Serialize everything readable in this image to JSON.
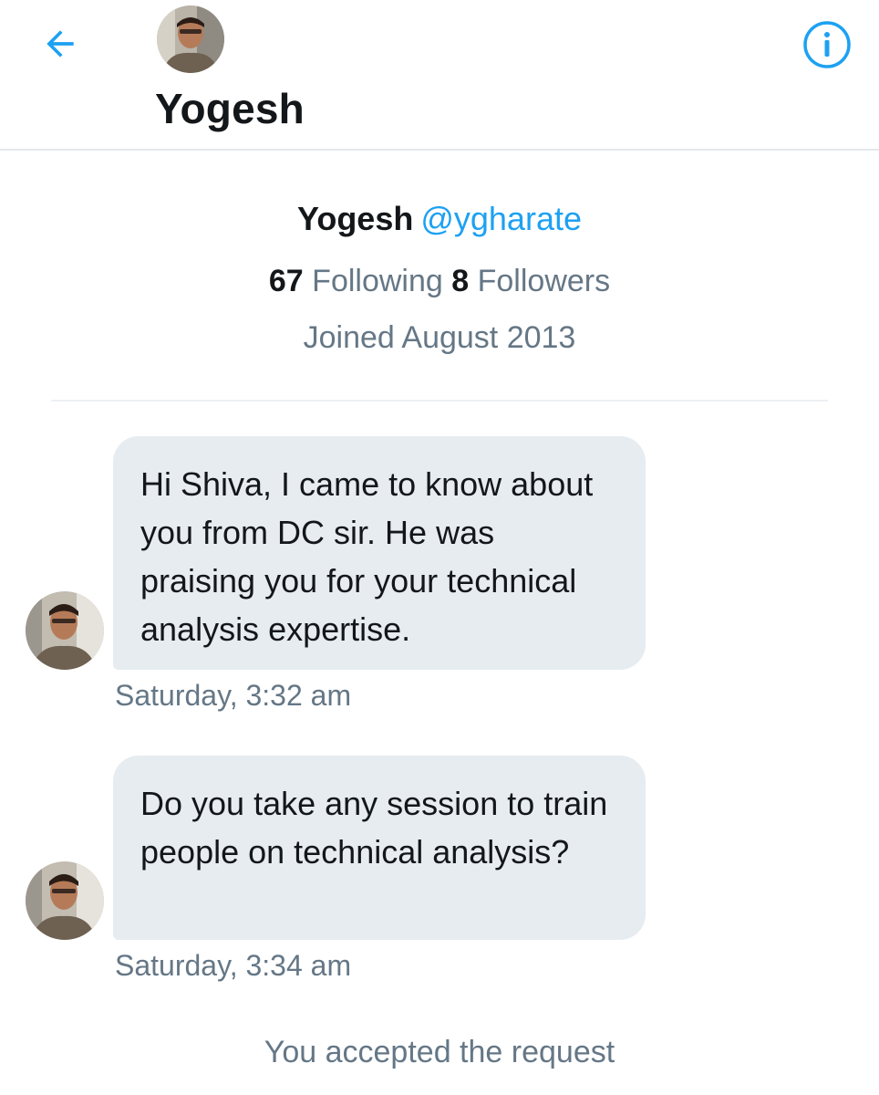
{
  "header": {
    "back_icon": "arrow-left-icon",
    "title": "Yogesh",
    "info_icon": "info-icon",
    "accent_color": "#1da1f2"
  },
  "profile": {
    "name": "Yogesh",
    "handle": "@ygharate",
    "following_count": "67",
    "following_label": "Following",
    "followers_count": "8",
    "followers_label": "Followers",
    "joined": "Joined August 2013"
  },
  "messages": [
    {
      "text": "Hi Shiva, I came to know about you from DC sir. He was praising you for your technical analysis expertise.",
      "timestamp": "Saturday, 3:32 am"
    },
    {
      "text": "Do you take any session to train people on technical analysis?",
      "timestamp": "Saturday, 3:34 am"
    }
  ],
  "system_note": "You accepted the request"
}
